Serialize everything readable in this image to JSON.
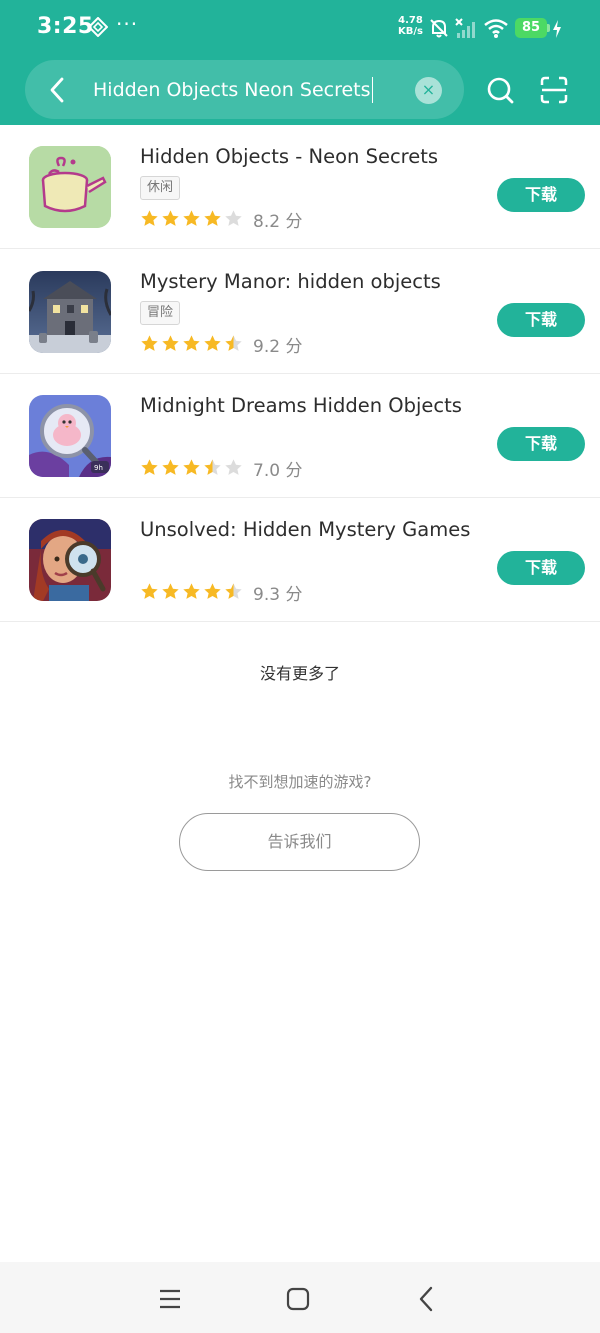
{
  "status_bar": {
    "time": "3:25",
    "more": "···",
    "net_speed_value": "4.78",
    "net_speed_unit": "KB/s",
    "battery": "85",
    "icons": [
      "diamond-icon",
      "bell-off-icon",
      "signal-icon",
      "wifi-icon",
      "charging-icon"
    ]
  },
  "search": {
    "query": "Hidden Objects Neon Secrets",
    "clear_label": "×"
  },
  "apps": [
    {
      "name": "Hidden Objects - Neon Secrets",
      "tag": "休闲",
      "rating": 4.0,
      "score": "8.2 分",
      "download_label": "下载"
    },
    {
      "name": "Mystery Manor: hidden objects",
      "tag": "冒险",
      "rating": 4.5,
      "score": "9.2 分",
      "download_label": "下载"
    },
    {
      "name": "Midnight Dreams Hidden Objects",
      "tag": "",
      "rating": 3.5,
      "score": "7.0 分",
      "download_label": "下载"
    },
    {
      "name": "Unsolved: Hidden Mystery Games",
      "tag": "",
      "rating": 4.5,
      "score": "9.3 分",
      "download_label": "下载"
    }
  ],
  "footer": {
    "no_more": "没有更多了",
    "not_found": "找不到想加速的游戏?",
    "tell_us": "告诉我们"
  },
  "colors": {
    "accent": "#22b39a",
    "star": "#f7b924",
    "star_empty": "#dcdcdc"
  }
}
